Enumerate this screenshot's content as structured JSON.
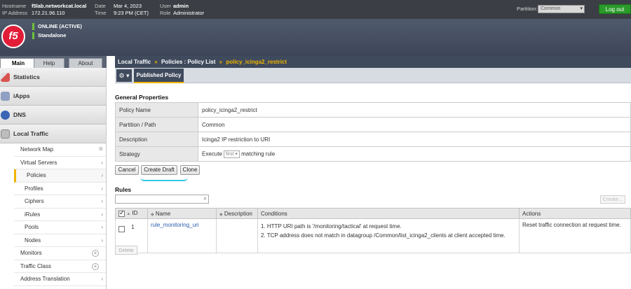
{
  "topbar": {
    "hostname_label": "Hostname",
    "hostname": "f5lab.networkcat.local",
    "ip_label": "IP Address",
    "ip": "172.21.96.110",
    "date_label": "Date",
    "date": "Mar 4, 2023",
    "time_label": "Time",
    "time": "9:23 PM (CET)",
    "user_label": "User",
    "user": "admin",
    "role_label": "Role",
    "role": "Administrator",
    "partition_label": "Partition:",
    "partition_value": "Common",
    "logout_label": "Log out"
  },
  "banner": {
    "logo_text": "f5",
    "status_line1": "ONLINE (ACTIVE)",
    "status_line2": "Standalone"
  },
  "nav": {
    "tabs": [
      "Main",
      "Help",
      "About"
    ],
    "sections": [
      {
        "label": "Statistics",
        "icon": "statistics-icon",
        "color": "#d9534f"
      },
      {
        "label": "iApps",
        "icon": "iapps-icon",
        "color": "#6b7fa8"
      },
      {
        "label": "DNS",
        "icon": "dns-icon",
        "color": "#3a66b5"
      },
      {
        "label": "Local Traffic",
        "icon": "local-traffic-icon",
        "color": "#7a7a7a"
      }
    ],
    "items": [
      {
        "label": "Network Map"
      },
      {
        "label": "Virtual Servers"
      },
      {
        "label": "Policies"
      },
      {
        "label": "Profiles"
      },
      {
        "label": "Ciphers"
      },
      {
        "label": "iRules"
      },
      {
        "label": "Pools"
      },
      {
        "label": "Nodes"
      },
      {
        "label": "Monitors"
      },
      {
        "label": "Traffic Class"
      },
      {
        "label": "Address Translation"
      }
    ]
  },
  "breadcrumb": {
    "part1": "Local Traffic",
    "sep": "»",
    "part2": "Policies : Policy List",
    "part3": "policy_icinga2_restrict"
  },
  "tabs": {
    "published": "Published Policy"
  },
  "general": {
    "title": "General Properties",
    "rows": [
      {
        "label": "Policy Name",
        "value": "policy_icinga2_restrict"
      },
      {
        "label": "Partition / Path",
        "value": "Common"
      },
      {
        "label": "Description",
        "value": "Icinga2 IP restriction to URI"
      },
      {
        "label": "Strategy",
        "value_prefix": "Execute",
        "select": "first",
        "value_suffix": "matching rule"
      }
    ]
  },
  "buttons": {
    "cancel": "Cancel",
    "create_draft": "Create Draft",
    "clone": "Clone",
    "create": "Create...",
    "delete": "Delete"
  },
  "rules": {
    "title": "Rules",
    "columns": {
      "id": "ID",
      "name": "Name",
      "description": "Description",
      "conditions": "Conditions",
      "actions": "Actions"
    },
    "rows": [
      {
        "id": "1",
        "name": "rule_monitoring_uri",
        "description": "",
        "condition1": "1. HTTP URI path is '/monitoring/tactical' at request time.",
        "condition2": "2. TCP address does not match in datagroup /Common/list_icinga2_clients at client accepted time.",
        "action": "Reset traffic connection at request time."
      }
    ]
  }
}
